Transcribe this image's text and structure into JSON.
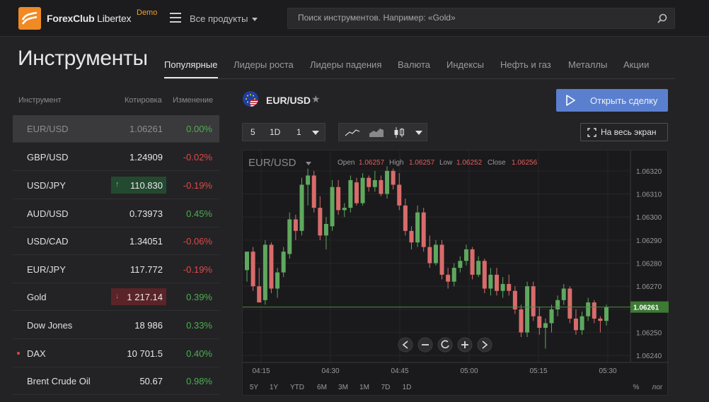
{
  "header": {
    "logo_bold": "ForexClub",
    "logo_regular": " Libertex",
    "demo_badge": "Demo",
    "all_products": "Все продукты",
    "search_placeholder": "Поиск инструментов. Например: «Gold»"
  },
  "page_title": "Инструменты",
  "tabs": [
    {
      "label": "Популярные",
      "active": true
    },
    {
      "label": "Лидеры роста"
    },
    {
      "label": "Лидеры падения"
    },
    {
      "label": "Валюта"
    },
    {
      "label": "Индексы"
    },
    {
      "label": "Нефть и газ"
    },
    {
      "label": "Металлы"
    },
    {
      "label": "Акции"
    }
  ],
  "list": {
    "col_instrument": "Инструмент",
    "col_quote": "Котировка",
    "col_change": "Изменение",
    "rows": [
      {
        "name": "EUR/USD",
        "price": "1.06261",
        "change": "0.00%",
        "dir": "up",
        "selected": true
      },
      {
        "name": "GBP/USD",
        "price": "1.24909",
        "change": "-0.02%",
        "dir": "dn"
      },
      {
        "name": "USD/JPY",
        "price": "110.830",
        "change": "-0.19%",
        "dir": "dn",
        "highlight": "up",
        "arrow": "↑"
      },
      {
        "name": "AUD/USD",
        "price": "0.73973",
        "change": "0.45%",
        "dir": "up"
      },
      {
        "name": "USD/CAD",
        "price": "1.34051",
        "change": "-0.06%",
        "dir": "dn"
      },
      {
        "name": "EUR/JPY",
        "price": "117.772",
        "change": "-0.19%",
        "dir": "dn"
      },
      {
        "name": "Gold",
        "price": "1 217.14",
        "change": "0.39%",
        "dir": "up",
        "highlight": "dn",
        "arrow": "↓"
      },
      {
        "name": "Dow Jones",
        "price": "18 986",
        "change": "0.33%",
        "dir": "up"
      },
      {
        "name": "DAX",
        "price": "10 701.5",
        "change": "0.40%",
        "dir": "up",
        "dot": true
      },
      {
        "name": "Brent Crude Oil",
        "price": "50.67",
        "change": "0.98%",
        "dir": "up"
      }
    ]
  },
  "instrument": {
    "symbol": "EUR/USD",
    "star": "★",
    "open_trade": "Открыть сделку",
    "fullscreen": "На весь экран",
    "toolbar": {
      "interval_a": "5",
      "interval_b": "1D",
      "interval_c": "1"
    }
  },
  "chart_data": {
    "type": "candlestick",
    "symbol_label": "EUR/USD",
    "ohlc_labels": {
      "open": "Open",
      "high": "High",
      "low": "Low",
      "close": "Close"
    },
    "ohlc_values": {
      "open": "1.06257",
      "high": "1.06257",
      "low": "1.06252",
      "close": "1.06256"
    },
    "current_price": "1.06261",
    "ylim": [
      1.06237,
      1.06327
    ],
    "yticks": [
      "1.06320",
      "1.06310",
      "1.06300",
      "1.06290",
      "1.06280",
      "1.06270",
      "1.06260",
      "1.06250",
      "1.06240"
    ],
    "xticks": [
      "04:15",
      "04:30",
      "04:45",
      "05:00",
      "05:15",
      "05:30"
    ],
    "periods": [
      "5Y",
      "1Y",
      "YTD",
      "6M",
      "3M",
      "1M",
      "7D",
      "1D"
    ],
    "scale_buttons": [
      "%",
      "лог"
    ],
    "candles": [
      [
        1.06277,
        1.06285,
        1.06272,
        1.06285
      ],
      [
        1.06285,
        1.06287,
        1.06268,
        1.0627
      ],
      [
        1.0627,
        1.06278,
        1.06263,
        1.06263
      ],
      [
        1.06264,
        1.0629,
        1.06262,
        1.06288
      ],
      [
        1.06288,
        1.06289,
        1.06267,
        1.06269
      ],
      [
        1.06269,
        1.06278,
        1.06265,
        1.06276
      ],
      [
        1.06276,
        1.06287,
        1.06274,
        1.06285
      ],
      [
        1.06284,
        1.06302,
        1.06282,
        1.06299
      ],
      [
        1.06299,
        1.06301,
        1.0629,
        1.06294
      ],
      [
        1.06294,
        1.06317,
        1.06292,
        1.06314
      ],
      [
        1.06314,
        1.06321,
        1.06305,
        1.06318
      ],
      [
        1.06318,
        1.0632,
        1.06302,
        1.06304
      ],
      [
        1.06304,
        1.06309,
        1.0629,
        1.06292
      ],
      [
        1.06292,
        1.063,
        1.06286,
        1.06297
      ],
      [
        1.06296,
        1.06316,
        1.06294,
        1.06313
      ],
      [
        1.06313,
        1.06316,
        1.06301,
        1.06303
      ],
      [
        1.06303,
        1.06306,
        1.063,
        1.06304
      ],
      [
        1.06304,
        1.06318,
        1.06302,
        1.06316
      ],
      [
        1.06315,
        1.06317,
        1.06305,
        1.06306
      ],
      [
        1.06306,
        1.06319,
        1.06305,
        1.06317
      ],
      [
        1.06317,
        1.06318,
        1.06311,
        1.06313
      ],
      [
        1.06313,
        1.0632,
        1.06311,
        1.06316
      ],
      [
        1.06316,
        1.06318,
        1.06309,
        1.0631
      ],
      [
        1.0631,
        1.06322,
        1.06308,
        1.0632
      ],
      [
        1.0632,
        1.06321,
        1.06312,
        1.06314
      ],
      [
        1.06314,
        1.06319,
        1.06303,
        1.06305
      ],
      [
        1.06305,
        1.06308,
        1.06292,
        1.06294
      ],
      [
        1.06294,
        1.06296,
        1.06286,
        1.06289
      ],
      [
        1.06289,
        1.06305,
        1.06287,
        1.06302
      ],
      [
        1.06302,
        1.06304,
        1.06285,
        1.06287
      ],
      [
        1.06287,
        1.06292,
        1.06278,
        1.0628
      ],
      [
        1.0628,
        1.0629,
        1.06279,
        1.06288
      ],
      [
        1.06288,
        1.0629,
        1.06273,
        1.06275
      ],
      [
        1.06275,
        1.06278,
        1.06269,
        1.06272
      ],
      [
        1.06272,
        1.0628,
        1.0627,
        1.06278
      ],
      [
        1.06278,
        1.06283,
        1.06276,
        1.06281
      ],
      [
        1.06281,
        1.06288,
        1.06279,
        1.06286
      ],
      [
        1.06286,
        1.06287,
        1.06273,
        1.06275
      ],
      [
        1.06275,
        1.06283,
        1.06274,
        1.06281
      ],
      [
        1.06281,
        1.06282,
        1.06267,
        1.06269
      ],
      [
        1.06269,
        1.06278,
        1.06266,
        1.06275
      ],
      [
        1.06275,
        1.06278,
        1.06266,
        1.06268
      ],
      [
        1.06268,
        1.06274,
        1.06265,
        1.06271
      ],
      [
        1.06271,
        1.06275,
        1.06266,
        1.06268
      ],
      [
        1.06268,
        1.0627,
        1.06258,
        1.0626
      ],
      [
        1.0626,
        1.06262,
        1.06248,
        1.0625
      ],
      [
        1.0625,
        1.06272,
        1.06248,
        1.0627
      ],
      [
        1.0627,
        1.06272,
        1.06255,
        1.06257
      ],
      [
        1.06257,
        1.06261,
        1.06249,
        1.06252
      ],
      [
        1.06252,
        1.06256,
        1.06243,
        1.06254
      ],
      [
        1.06254,
        1.06262,
        1.0625,
        1.0626
      ],
      [
        1.0626,
        1.06266,
        1.06257,
        1.06264
      ],
      [
        1.06264,
        1.06271,
        1.06262,
        1.06269
      ],
      [
        1.06269,
        1.0627,
        1.06254,
        1.06256
      ],
      [
        1.06256,
        1.0626,
        1.06249,
        1.06251
      ],
      [
        1.06251,
        1.06259,
        1.06249,
        1.06257
      ],
      [
        1.06257,
        1.06265,
        1.06255,
        1.06263
      ],
      [
        1.06263,
        1.06264,
        1.06254,
        1.06256
      ],
      [
        1.06256,
        1.06257,
        1.0625,
        1.06255
      ],
      [
        1.06255,
        1.06262,
        1.06253,
        1.06261
      ]
    ]
  },
  "colors": {
    "up": "#5fa85f",
    "down": "#d96b6b",
    "accent": "#5b7fcf",
    "logo": "#f08a24"
  }
}
